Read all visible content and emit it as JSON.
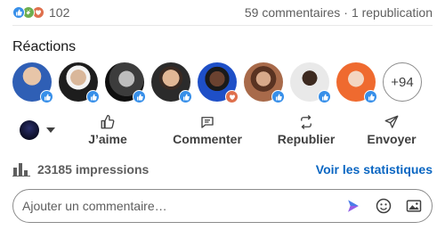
{
  "social": {
    "reaction_icons": [
      "like-icon",
      "celebrate-icon",
      "love-icon"
    ],
    "reaction_count": "102",
    "comments": "59 commentaires",
    "separator": "·",
    "reposts": "1 republication"
  },
  "reactions": {
    "title": "Réactions",
    "avatars": [
      {
        "name": "avatar-1",
        "badge": "like"
      },
      {
        "name": "avatar-2",
        "badge": "like"
      },
      {
        "name": "avatar-3",
        "badge": "like"
      },
      {
        "name": "avatar-4",
        "badge": "like"
      },
      {
        "name": "avatar-5",
        "badge": "love"
      },
      {
        "name": "avatar-6",
        "badge": "like"
      },
      {
        "name": "avatar-7",
        "badge": "like"
      },
      {
        "name": "avatar-8",
        "badge": "like"
      }
    ],
    "more_label": "+94"
  },
  "actions": {
    "like": "J’aime",
    "comment": "Commenter",
    "repost": "Republier",
    "send": "Envoyer"
  },
  "stats": {
    "impressions": "23185 impressions",
    "link": "Voir les statistiques"
  },
  "comment": {
    "placeholder": "Ajouter un commentaire…"
  },
  "colors": {
    "like": "#378fe9",
    "celebrate": "#6dae4f",
    "love": "#df704d",
    "link": "#0a66c2"
  }
}
